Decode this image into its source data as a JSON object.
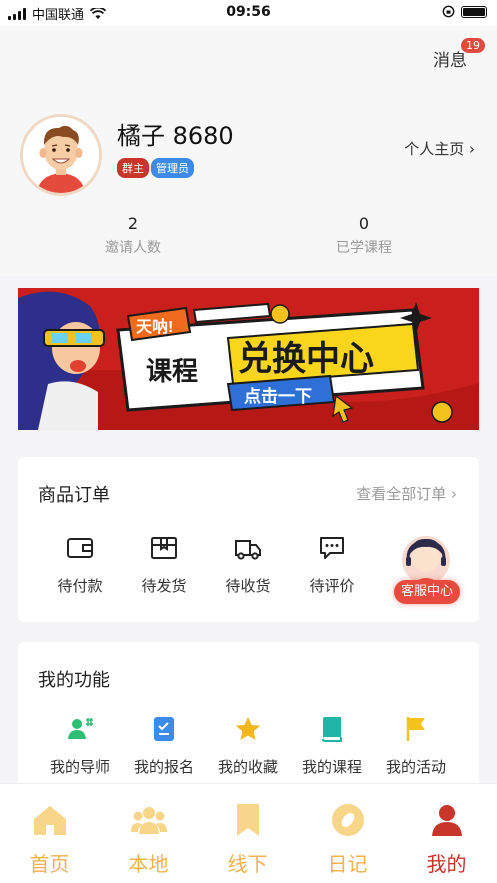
{
  "status_bar": {
    "carrier": "中国联通",
    "time": "09:56"
  },
  "header": {
    "messages_label": "消息",
    "messages_count": "19"
  },
  "profile": {
    "name": "橘子 8680",
    "tags": [
      "群主",
      "管理员"
    ],
    "homepage_link": "个人主页 ›"
  },
  "stats": [
    {
      "value": "2",
      "label": "邀请人数"
    },
    {
      "value": "0",
      "label": "已学课程"
    }
  ],
  "banner": {
    "tag": "天呐!",
    "title_left": "课程",
    "title_right": "兑换中心",
    "button": "点击一下"
  },
  "orders": {
    "title": "商品订单",
    "view_all": "查看全部订单 ›",
    "items": [
      {
        "label": "待付款",
        "icon": "wallet-icon"
      },
      {
        "label": "待发货",
        "icon": "package-icon"
      },
      {
        "label": "待收货",
        "icon": "truck-icon"
      },
      {
        "label": "待评价",
        "icon": "comment-icon"
      }
    ]
  },
  "customer_service": {
    "label": "客服中心"
  },
  "functions": {
    "title": "我的功能",
    "items": [
      {
        "label": "我的导师",
        "icon": "mentor-icon",
        "color": "#2cbf74"
      },
      {
        "label": "我的报名",
        "icon": "clipboard-icon",
        "color": "#3d8be8"
      },
      {
        "label": "我的收藏",
        "icon": "star-icon",
        "color": "#f4b51d"
      },
      {
        "label": "我的课程",
        "icon": "book-icon",
        "color": "#1fb6a6"
      },
      {
        "label": "我的活动",
        "icon": "flag-icon",
        "color": "#f4c21d"
      }
    ]
  },
  "tabs": [
    {
      "label": "首页",
      "icon": "home-icon",
      "active": false
    },
    {
      "label": "本地",
      "icon": "group-icon",
      "active": false
    },
    {
      "label": "线下",
      "icon": "bookmark-icon",
      "active": false
    },
    {
      "label": "日记",
      "icon": "compass-icon",
      "active": false
    },
    {
      "label": "我的",
      "icon": "user-icon",
      "active": true
    }
  ],
  "colors": {
    "accent": "#c8352b",
    "tab_inactive": "#f2b24c",
    "tab_active": "#c8352b"
  }
}
